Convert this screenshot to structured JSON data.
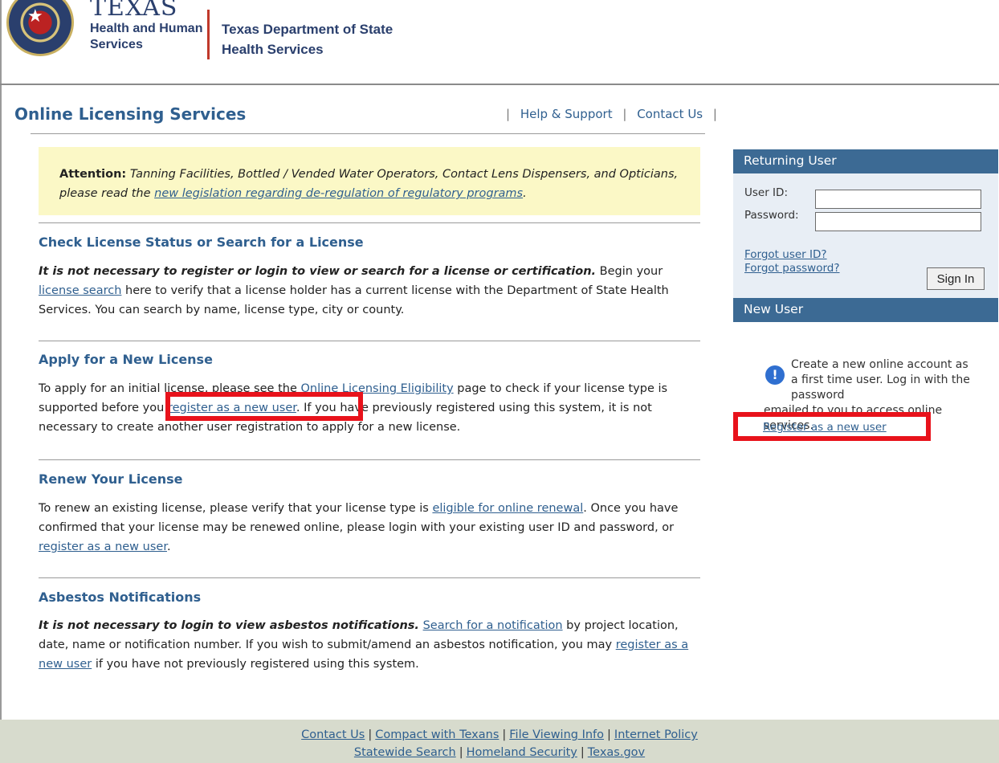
{
  "header": {
    "brand_line1": "TEXAS",
    "brand_line2": "Health and Human",
    "brand_line3": "Services",
    "dept_line1": "Texas Department of State",
    "dept_line2": "Health Services",
    "star_icon": "star-icon"
  },
  "title": "Online Licensing Services",
  "toplinks": {
    "sep": "|",
    "help": "Help & Support",
    "contact": "Contact Us"
  },
  "attention": {
    "label": "Attention:",
    "text": " Tanning Facilities, Bottled / Vended Water Operators, Contact Lens Dispensers, and Opticians, please read the ",
    "link": "new legislation regarding de-regulation of regulatory programs",
    "end": "."
  },
  "sections": {
    "check": {
      "heading": "Check License Status or Search for a License",
      "bold": "It is not necessary to register or login to view or search for a license or certification.",
      "t1": " Begin your ",
      "link": "license search",
      "t2": " here to verify that a license holder has a current license with the Department of State Health Services. You can search by name, license type, city or county."
    },
    "apply": {
      "heading": "Apply for a New License",
      "t1": "To apply for an initial license, please see the ",
      "link1": "Online Licensing Eligibility",
      "t2": " page to check if your license type is supported before you ",
      "link2": "register as a new user",
      "t3": ". If you have previously registered using this system, it is not necessary to create another user registration to apply for a new license."
    },
    "renew": {
      "heading": "Renew Your License",
      "t1": "To renew an existing license, please verify that your license type is ",
      "link1": "eligible for online renewal",
      "t2": ". Once you have confirmed that your license may be renewed online, please login with your existing user ID and password, or ",
      "link2": "register as a new user",
      "t3": "."
    },
    "asbestos": {
      "heading": "Asbestos Notifications",
      "bold": "It is not necessary to login to view asbestos notifications.",
      "t1": " ",
      "link1": "Search for a notification",
      "t2": " by project location, date, name or notification number. If you wish to submit/amend an asbestos notification, you may ",
      "link2": "register as a new user",
      "t3": " if you have not previously registered using this system."
    }
  },
  "login": {
    "heading": "Returning User",
    "userid_label": "User ID:",
    "password_label": "Password:",
    "userid_value": "",
    "password_value": "",
    "forgot_user": "Forgot user ID?",
    "forgot_password": "Forgot password?",
    "signin": "Sign In"
  },
  "newuser": {
    "heading": "New User",
    "info_icon": "info-icon",
    "text1": "Create a new online account as a first time user. Log in with the password",
    "text2": "emailed to you to access online services.",
    "link": "Register as a new user"
  },
  "footer": {
    "sep": "|",
    "row1": [
      "Contact Us",
      "Compact with Texans",
      "File Viewing Info",
      "Internet Policy"
    ],
    "row2": [
      "Statewide Search",
      "Homeland Security",
      "Texas.gov"
    ]
  },
  "colors": {
    "accent": "#2f5f8f",
    "panel_header": "#3c6a94",
    "highlight": "#e8121b",
    "attention_bg": "#fbf8c6",
    "footer_bg": "#d7dbcd"
  }
}
